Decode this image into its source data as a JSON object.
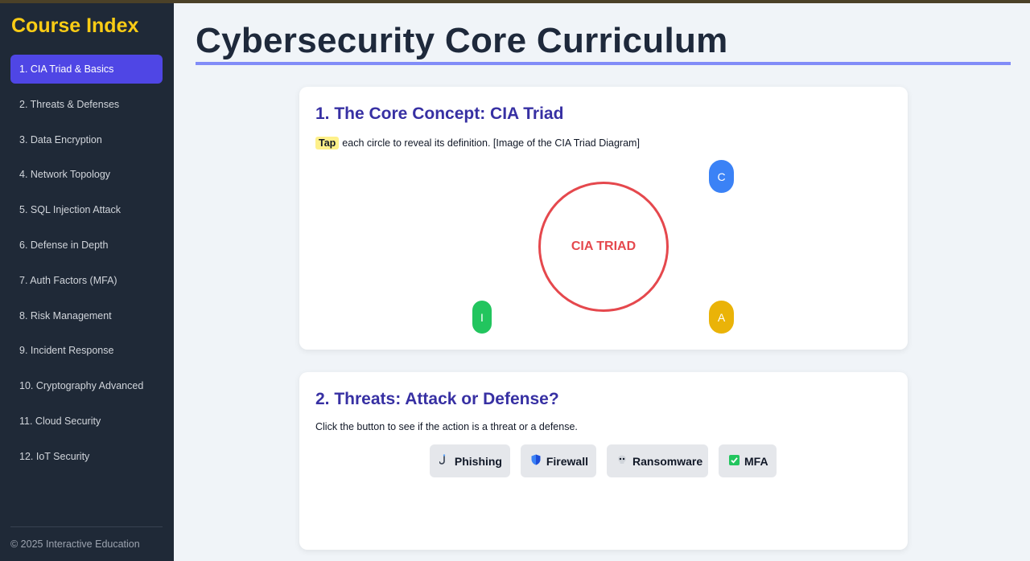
{
  "sidebar": {
    "title": "Course Index",
    "items": [
      {
        "label": "1. CIA Triad & Basics",
        "active": true
      },
      {
        "label": "2. Threats & Defenses"
      },
      {
        "label": "3. Data Encryption"
      },
      {
        "label": "4. Network Topology"
      },
      {
        "label": "5. SQL Injection Attack"
      },
      {
        "label": "6. Defense in Depth"
      },
      {
        "label": "7. Auth Factors (MFA)"
      },
      {
        "label": "8. Risk Management"
      },
      {
        "label": "9. Incident Response"
      },
      {
        "label": "10. Cryptography Advanced"
      },
      {
        "label": "11. Cloud Security"
      },
      {
        "label": "12. IoT Security"
      }
    ],
    "footer": "© 2025 Interactive Education"
  },
  "main": {
    "title": "Cybersecurity Core Curriculum",
    "section1": {
      "heading": "1. The Core Concept: CIA Triad",
      "tap_label": "Tap",
      "instruction": "each circle to reveal its definition. [Image of the CIA Triad Diagram]",
      "center_label": "CIA TRIAD",
      "pills": {
        "c": "C",
        "i": "I",
        "a": "A"
      }
    },
    "section2": {
      "heading": "2. Threats: Attack or Defense?",
      "instruction": "Click the button to see if the action is a threat or a defense.",
      "buttons": [
        {
          "label": "Phishing",
          "icon": "🎣"
        },
        {
          "label": "Firewall",
          "icon": "🛡"
        },
        {
          "label": "Ransomware",
          "icon": "💀"
        },
        {
          "label": "MFA",
          "icon": "✅"
        }
      ]
    }
  },
  "colors": {
    "sidebar_bg": "#1f2937",
    "sidebar_title": "#facc15",
    "active_item": "#4f46e5",
    "heading": "#3730a3",
    "triad_red": "#e5484d",
    "pill_c": "#3b82f6",
    "pill_i": "#22c55e",
    "pill_a": "#eab308"
  }
}
